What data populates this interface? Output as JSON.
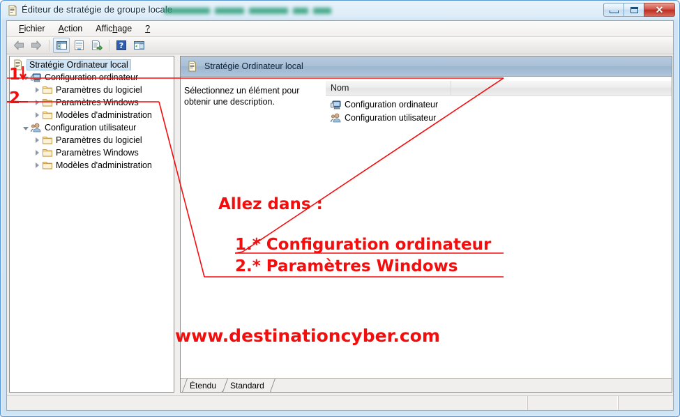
{
  "window": {
    "title": "Éditeur de stratégie de groupe locale",
    "title_icon": "policy-document-icon",
    "redacted_suffix": "",
    "controls": {
      "minimize": "minimize-button",
      "maximize": "maximize-button",
      "close": "close-button",
      "close_glyph": "✕"
    }
  },
  "menubar": {
    "items": [
      {
        "label": "Fichier",
        "accel": "F",
        "rest": "ichier"
      },
      {
        "label": "Action",
        "accel": "A",
        "rest": "ction"
      },
      {
        "label": "Affichage",
        "pre": "Affic",
        "accel": "h",
        "rest": "age"
      },
      {
        "label": "?",
        "accel": "?",
        "rest": ""
      }
    ]
  },
  "toolbar": {
    "buttons": [
      {
        "name": "back-button",
        "label": "Précédent"
      },
      {
        "name": "forward-button",
        "label": "Suivant"
      },
      {
        "name": "show-hide-tree-button",
        "label": "Afficher/Masquer l'arborescence"
      },
      {
        "name": "properties-button",
        "label": "Propriétés"
      },
      {
        "name": "export-list-button",
        "label": "Exporter la liste"
      },
      {
        "name": "help-button",
        "label": "Aide"
      },
      {
        "name": "show-pane-button",
        "label": "Afficher le volet"
      }
    ]
  },
  "tree": {
    "items": [
      {
        "label": "Stratégie Ordinateur local",
        "icon": "policy-document-icon",
        "indent": 0,
        "expander": "none",
        "selected": true
      },
      {
        "label": "Configuration ordinateur",
        "icon": "computer-icon",
        "indent": 1,
        "expander": "expanded",
        "selected": false
      },
      {
        "label": "Paramètres du logiciel",
        "icon": "folder-icon",
        "indent": 2,
        "expander": "collapsed",
        "selected": false
      },
      {
        "label": "Paramètres Windows",
        "icon": "folder-icon",
        "indent": 2,
        "expander": "collapsed",
        "selected": false
      },
      {
        "label": "Modèles d'administration",
        "icon": "folder-icon",
        "indent": 2,
        "expander": "collapsed",
        "selected": false
      },
      {
        "label": "Configuration utilisateur",
        "icon": "user-icon",
        "indent": 1,
        "expander": "expanded",
        "selected": false
      },
      {
        "label": "Paramètres du logiciel",
        "icon": "folder-icon",
        "indent": 2,
        "expander": "collapsed",
        "selected": false
      },
      {
        "label": "Paramètres Windows",
        "icon": "folder-icon",
        "indent": 2,
        "expander": "collapsed",
        "selected": false
      },
      {
        "label": "Modèles d'administration",
        "icon": "folder-icon",
        "indent": 2,
        "expander": "collapsed",
        "selected": false
      }
    ]
  },
  "right_pane": {
    "header_title": "Stratégie Ordinateur local",
    "header_icon": "policy-document-icon",
    "description": "Sélectionnez un élément pour obtenir une description.",
    "list": {
      "columns": [
        "Nom",
        ""
      ],
      "rows": [
        {
          "name": "Configuration ordinateur",
          "icon": "computer-icon"
        },
        {
          "name": "Configuration utilisateur",
          "icon": "user-icon"
        }
      ]
    },
    "tabs": [
      {
        "label": "Étendu",
        "active": false
      },
      {
        "label": "Standard",
        "active": true
      }
    ]
  },
  "statusbar": {
    "pane1": "",
    "pane2": "",
    "pane3": ""
  },
  "annotations": {
    "color": "#f40d0d",
    "marker_1": "1",
    "marker_2": "2",
    "heading": "Allez dans :",
    "step_1": "1.* Configuration ordinateur",
    "step_2": "2.* Paramètres Windows",
    "website": "www.destinationcyber.com"
  }
}
